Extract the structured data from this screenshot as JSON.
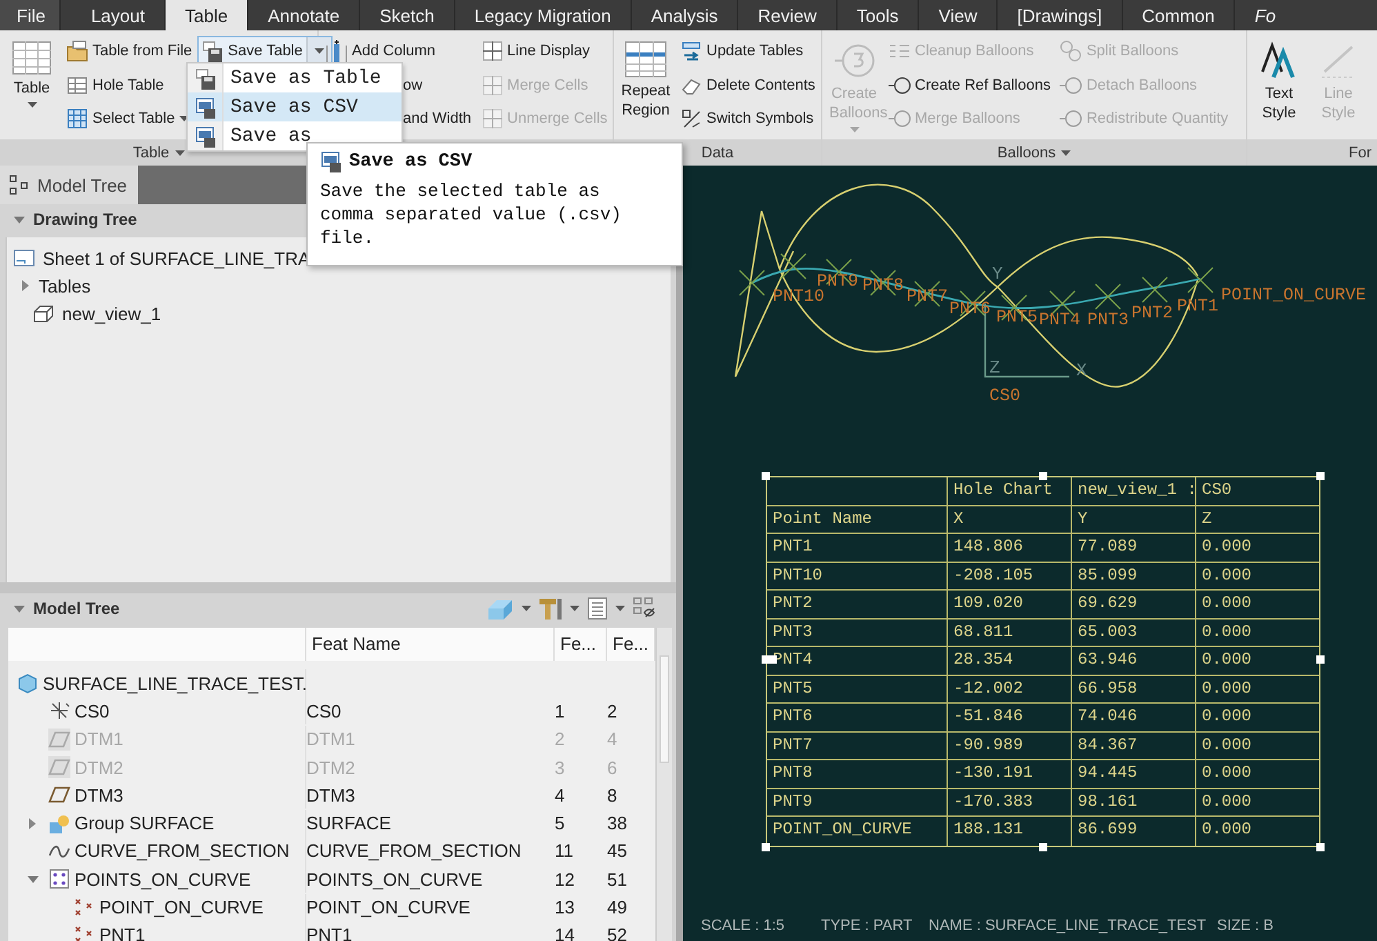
{
  "tabs": [
    {
      "label": "File",
      "selected": false
    },
    {
      "label": "Layout",
      "selected": false
    },
    {
      "label": "Table",
      "selected": true
    },
    {
      "label": "Annotate",
      "selected": false
    },
    {
      "label": "Sketch",
      "selected": false
    },
    {
      "label": "Legacy Migration",
      "selected": false
    },
    {
      "label": "Analysis",
      "selected": false
    },
    {
      "label": "Review",
      "selected": false
    },
    {
      "label": "Tools",
      "selected": false
    },
    {
      "label": "View",
      "selected": false
    },
    {
      "label": "[Drawings]",
      "selected": false
    },
    {
      "label": "Common",
      "selected": false
    },
    {
      "label": "Fo",
      "selected": false
    }
  ],
  "ribbon": {
    "groups": [
      {
        "label": "Table",
        "has_menu": true,
        "columns": [
          [
            {
              "kind": "large",
              "label": "Table",
              "has_menu": true,
              "disabled": false
            }
          ],
          [
            {
              "kind": "small",
              "label": "Table from File",
              "disabled": false
            },
            {
              "kind": "small",
              "label": "Hole Table",
              "disabled": false
            },
            {
              "kind": "small",
              "label": "Select Table",
              "has_menu": true,
              "disabled": false
            }
          ],
          [
            {
              "kind": "small",
              "label": "Save Table",
              "has_menu": true,
              "open": true,
              "disabled": false
            }
          ]
        ]
      },
      {
        "columns": [
          [
            {
              "kind": "small",
              "label": "Add Column",
              "disabled": false
            },
            {
              "kind": "partial",
              "label": "ow",
              "disabled": false
            },
            {
              "kind": "partial",
              "label": "and Width",
              "disabled": false
            }
          ],
          [
            {
              "kind": "small",
              "label": "Line Display",
              "disabled": false
            },
            {
              "kind": "small",
              "label": "Merge Cells",
              "disabled": true
            },
            {
              "kind": "small",
              "label": "Unmerge Cells",
              "disabled": true
            }
          ]
        ]
      },
      {
        "label": "Data",
        "has_menu": false,
        "columns": [
          [
            {
              "kind": "large",
              "label": "Repeat Region",
              "disabled": false
            }
          ],
          [
            {
              "kind": "small",
              "label": "Update Tables",
              "disabled": false
            },
            {
              "kind": "small",
              "label": "Delete Contents",
              "disabled": false
            },
            {
              "kind": "small",
              "label": "Switch Symbols",
              "disabled": false
            }
          ]
        ]
      },
      {
        "label": "Balloons",
        "has_menu": true,
        "columns": [
          [
            {
              "kind": "large",
              "label": "Create Balloons",
              "has_menu": true,
              "disabled": true
            }
          ],
          [
            {
              "kind": "small",
              "label": "Cleanup Balloons",
              "disabled": true
            },
            {
              "kind": "small",
              "label": "Create Ref Balloons",
              "disabled": false
            },
            {
              "kind": "small",
              "label": "Merge Balloons",
              "disabled": true
            }
          ],
          [
            {
              "kind": "small",
              "label": "Split Balloons",
              "disabled": true
            },
            {
              "kind": "small",
              "label": "Detach Balloons",
              "disabled": true
            },
            {
              "kind": "small",
              "label": "Redistribute Quantity",
              "disabled": true
            }
          ]
        ]
      },
      {
        "label": "For",
        "has_menu": false,
        "columns": [
          [
            {
              "kind": "large",
              "label": "Text Style",
              "disabled": false
            }
          ],
          [
            {
              "kind": "large",
              "label": "Line Style",
              "disabled": true
            }
          ]
        ]
      }
    ]
  },
  "save_menu": {
    "items": [
      {
        "label": "Save as Table",
        "selected": false
      },
      {
        "label": "Save as CSV",
        "selected": true
      },
      {
        "label": "Save as",
        "selected": false
      }
    ]
  },
  "tooltip": {
    "title": "Save as CSV",
    "text": "Save the selected table as comma separated value (.csv) file."
  },
  "panel_tab": "Model Tree",
  "drawing_tree": {
    "title": "Drawing Tree",
    "expanded": true,
    "items": [
      {
        "label": "Sheet 1 of SURFACE_LINE_TRA"
      },
      {
        "label": "Tables",
        "expanded": false
      },
      {
        "label": "new_view_1"
      }
    ]
  },
  "model_tree": {
    "title": "Model Tree",
    "expanded": true,
    "columns": [
      "Feat Name",
      "Fe...",
      "Fe..."
    ],
    "rows": [
      {
        "kind": "part",
        "name": "SURFACE_LINE_TRACE_TEST.",
        "hidden": false,
        "children": [
          {
            "kind": "csys",
            "name": "CS0",
            "feat_name": "CS0",
            "col_2": "1",
            "col_3": "2",
            "hidden": false
          },
          {
            "kind": "plane",
            "name": "DTM1",
            "feat_name": "DTM1",
            "col_2": "2",
            "col_3": "4",
            "hidden": true
          },
          {
            "kind": "plane",
            "name": "DTM2",
            "feat_name": "DTM2",
            "col_2": "3",
            "col_3": "6",
            "hidden": true
          },
          {
            "kind": "plane",
            "name": "DTM3",
            "feat_name": "DTM3",
            "col_2": "4",
            "col_3": "8",
            "hidden": false
          },
          {
            "kind": "group",
            "name": "Group SURFACE",
            "feat_name": "SURFACE",
            "col_2": "5",
            "col_3": "38",
            "hidden": false,
            "expanded": false
          },
          {
            "kind": "curve",
            "name": "CURVE_FROM_SECTION",
            "feat_name": "CURVE_FROM_SECTION",
            "col_2": "11",
            "col_3": "45",
            "hidden": false
          },
          {
            "kind": "pattern",
            "name": "POINTS_ON_CURVE",
            "feat_name": "POINTS_ON_CURVE",
            "col_2": "12",
            "col_3": "51",
            "hidden": false,
            "expanded": true,
            "children": [
              {
                "kind": "point",
                "name": "POINT_ON_CURVE",
                "feat_name": "POINT_ON_CURVE",
                "col_2": "13",
                "col_3": "49",
                "hidden": false
              },
              {
                "kind": "point",
                "name": "PNT1",
                "feat_name": "PNT1",
                "col_2": "14",
                "col_3": "52",
                "hidden": false
              }
            ]
          }
        ]
      }
    ]
  },
  "drawing": {
    "point_labels": [
      "PNT10",
      "PNT9",
      "PNT8",
      "PNT7",
      "PNT6",
      "PNT5",
      "PNT4",
      "PNT3",
      "PNT2",
      "PNT1",
      "POINT_ON_CURVE"
    ],
    "axis_labels": [
      "Y",
      "Z",
      "X"
    ],
    "csys_label": "CS0"
  },
  "drawing_table": {
    "selected": true,
    "title_cells": [
      "Hole Chart",
      "new_view_1 :",
      "CS0"
    ],
    "header": [
      "Point Name",
      "X",
      "Y",
      "Z"
    ],
    "rows": [
      [
        "PNT1",
        "148.806",
        "77.089",
        "0.000"
      ],
      [
        "PNT10",
        "-208.105",
        "85.099",
        "0.000"
      ],
      [
        "PNT2",
        "109.020",
        "69.629",
        "0.000"
      ],
      [
        "PNT3",
        "68.811",
        "65.003",
        "0.000"
      ],
      [
        "PNT4",
        "28.354",
        "63.946",
        "0.000"
      ],
      [
        "PNT5",
        "-12.002",
        "66.958",
        "0.000"
      ],
      [
        "PNT6",
        "-51.846",
        "74.046",
        "0.000"
      ],
      [
        "PNT7",
        "-90.989",
        "84.367",
        "0.000"
      ],
      [
        "PNT8",
        "-130.191",
        "94.445",
        "0.000"
      ],
      [
        "PNT9",
        "-170.383",
        "98.161",
        "0.000"
      ],
      [
        "POINT_ON_CURVE",
        "188.131",
        "86.699",
        "0.000"
      ]
    ]
  },
  "status": [
    "SCALE : 1:5",
    "TYPE : PART",
    "NAME : SURFACE_LINE_TRACE_TEST",
    "SIZE : B"
  ]
}
